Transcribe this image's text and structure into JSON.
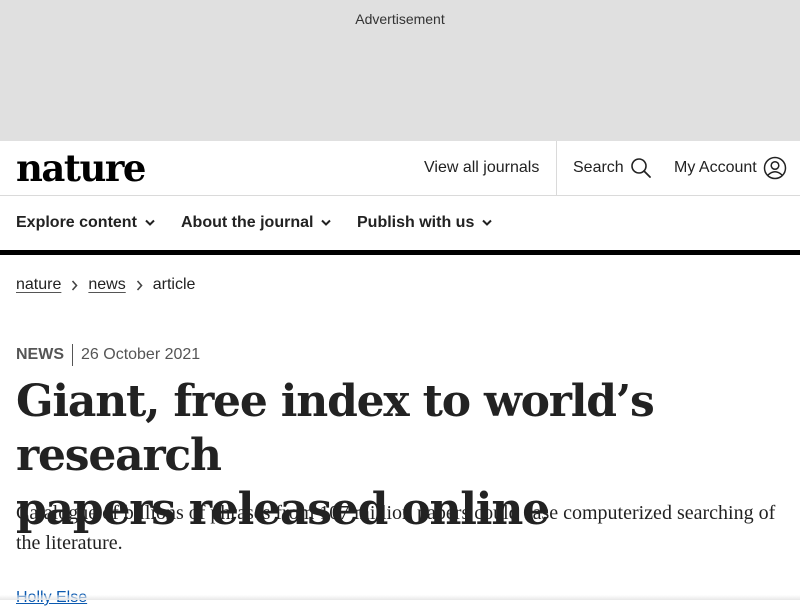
{
  "ad": {
    "label": "Advertisement"
  },
  "header": {
    "logo": "nature",
    "view_all": "View all journals",
    "search": "Search",
    "account": "My Account"
  },
  "nav": {
    "items": [
      {
        "label": "Explore content"
      },
      {
        "label": "About the journal"
      },
      {
        "label": "Publish with us"
      }
    ]
  },
  "breadcrumb": [
    "nature",
    "news",
    "article"
  ],
  "article": {
    "type": "NEWS",
    "date": "26 October 2021",
    "title_line1": "Giant, free index to world’s research",
    "title_line2": "papers released online",
    "standfirst": "Catalogue of billions of phrases from 107 million papers could ease computerized searching of the literature.",
    "author": "Holly Else"
  },
  "icons": {
    "search": "search-icon",
    "account": "user-circle-icon",
    "chevron": "chevron-down-icon",
    "crumb_separator": "chevron-right-icon"
  }
}
